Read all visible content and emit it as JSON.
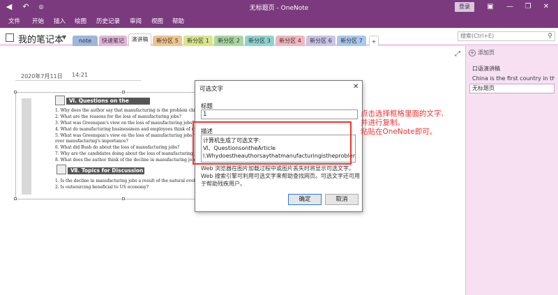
{
  "window": {
    "title": "无标题页 - OneNote",
    "login_label": "登录"
  },
  "menu": [
    "文件",
    "开始",
    "插入",
    "绘图",
    "历史记录",
    "审阅",
    "视图",
    "帮助"
  ],
  "notebook": {
    "name": "我的笔记本",
    "tabs": [
      {
        "label": "note",
        "color": "#9fb6dc"
      },
      {
        "label": "快速笔记",
        "color": "#e3b3d8"
      },
      {
        "label": "演讲稿",
        "color": "#ffffff"
      },
      {
        "label": "新分区 5",
        "color": "#f1c38e"
      },
      {
        "label": "新分区 1",
        "color": "#d9e58a"
      },
      {
        "label": "新分区 2",
        "color": "#a8d8a0"
      },
      {
        "label": "新分区 3",
        "color": "#8fd3d0"
      },
      {
        "label": "新分区 4",
        "color": "#f2b6c0"
      },
      {
        "label": "新分区 6",
        "color": "#c9c3e8"
      },
      {
        "label": "新分区 7",
        "color": "#a9c8ef"
      }
    ],
    "add_tab": "+",
    "search_placeholder": "搜索(Ctrl+E)"
  },
  "page": {
    "date": "2020年7月11日",
    "time": "14:21"
  },
  "image": {
    "header1": "Ⅵ. Questions on the Article",
    "header2": "Ⅶ. Topics for Discussion",
    "questions": [
      "1. Why does the author say that manufacturing is the problem child?",
      "2. What are the reasons for the loss of manufacturing jobs?",
      "3. What was Greenspan's view on the loss of manufacturing jobs?",
      "4. What do manufacturing businessmen and employees think of manufacturing?",
      "5. What was Greenspan's view on the loss of manufacturing jobs?",
      "   over manufacturing's importance?",
      "6. What did Bush do about the loss of manufacturing jobs?",
      "7. Why are the candidates doing about the loss of manufacturing jobs?",
      "8. What does the author think of the decline in manufacturing jobs?"
    ],
    "topics": [
      "1. Is the decline in manufacturing jobs a result of the natural evolution?",
      "2. Is outsourcing beneficial to US economy?"
    ]
  },
  "dialog": {
    "title": "可选文字",
    "close_glyph": "✕",
    "title_label": "标题",
    "title_value": "1",
    "desc_label": "描述",
    "desc_lines": [
      "计算机生成了可选文字:",
      "Ⅵ、QuestionsontheArticle",
      "l.Whydoestheauthorsaythatmanufacturingistheproblemchi"
    ],
    "help_text": "Web 浏览器在图片加载过程中或图片丢失时将显示可选文字。Web 搜索引擎可利用可选文字来帮助查找网页。可选文字还可用于帮助残疾用户。",
    "ok_label": "确定",
    "cancel_label": "取消"
  },
  "annotation": [
    "点击选择框格里面的文字,",
    "并进行复制。",
    "粘贴在OneNote即可。"
  ],
  "pages_pane": {
    "add_page": "添加页",
    "entries": [
      "口语演讲稿",
      "China is the first country in the",
      "无标题页"
    ]
  },
  "colors": {
    "accent": "#7b3a7e",
    "pane": "#f6e0f2",
    "annotation": "#e33333"
  }
}
